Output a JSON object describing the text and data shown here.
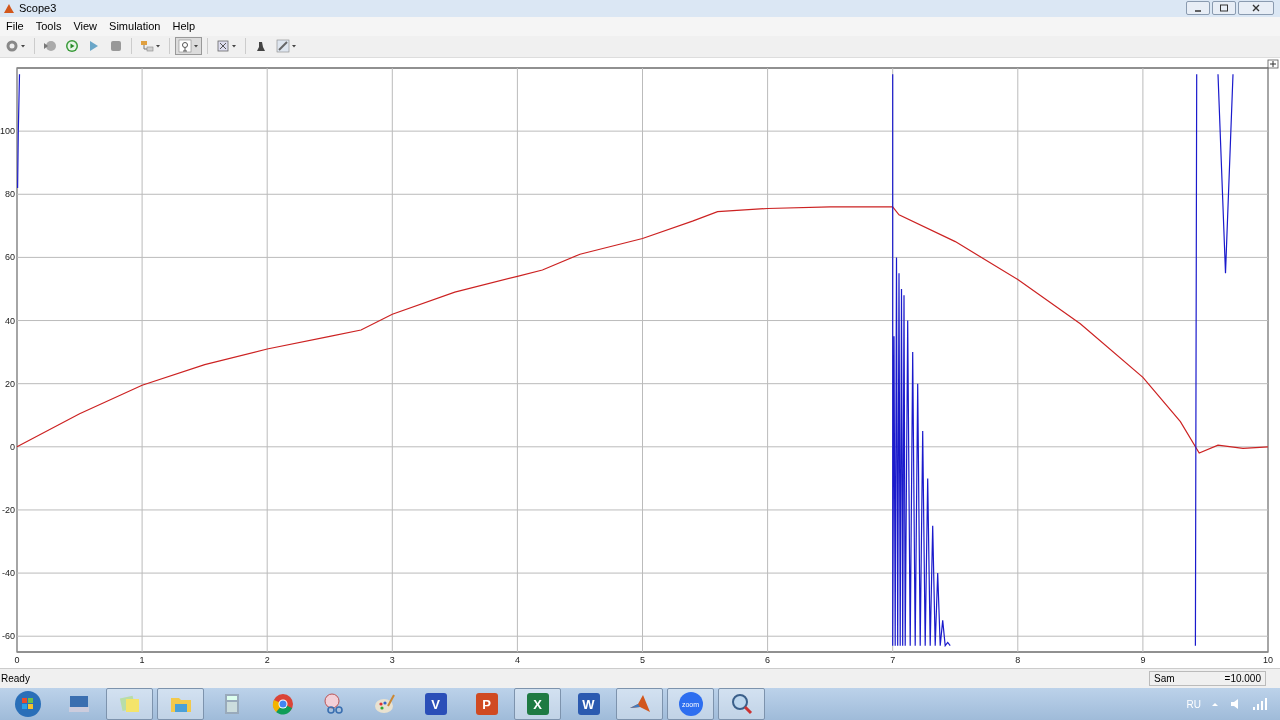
{
  "window": {
    "title": "Scope3"
  },
  "menu": [
    "File",
    "Tools",
    "View",
    "Simulation",
    "Help"
  ],
  "toolbar": [
    {
      "kind": "gear",
      "caret": true,
      "pressed": false
    },
    {
      "kind": "step-back",
      "caret": false,
      "pressed": false
    },
    {
      "kind": "run",
      "caret": false,
      "pressed": false
    },
    {
      "kind": "play",
      "caret": false,
      "pressed": false
    },
    {
      "kind": "stop",
      "caret": false,
      "pressed": false
    },
    {
      "kind": "blocks",
      "caret": true,
      "pressed": false
    },
    {
      "kind": "zoom",
      "caret": true,
      "pressed": true
    },
    {
      "kind": "fit",
      "caret": true,
      "pressed": false
    },
    {
      "kind": "stamp",
      "caret": false,
      "pressed": false
    },
    {
      "kind": "pencil",
      "caret": true,
      "pressed": false
    }
  ],
  "plot": {
    "chart_data": {
      "type": "line",
      "grid": true,
      "xlim": [
        0,
        10
      ],
      "ylim": [
        -65,
        120
      ],
      "xticks": [
        0,
        1,
        2,
        3,
        4,
        5,
        6,
        7,
        8,
        9,
        10
      ],
      "yticks": [
        -60,
        -40,
        -20,
        0,
        20,
        40,
        60,
        80,
        100
      ],
      "series": [
        {
          "color": "#cc2222",
          "x": [
            0,
            0.5,
            1,
            1.5,
            2,
            2.5,
            2.75,
            3,
            3.5,
            4,
            4.2,
            4.5,
            5,
            5.4,
            5.6,
            6,
            6.5,
            7,
            7.05,
            7.5,
            8,
            8.5,
            9,
            9.3,
            9.45,
            9.6,
            9.8,
            10
          ],
          "values": [
            0,
            10.5,
            19.5,
            26,
            31,
            35,
            37,
            42,
            49,
            54,
            56,
            61,
            66,
            71.5,
            74.5,
            75.5,
            76,
            76,
            73.5,
            65,
            53,
            39,
            22,
            8,
            -2,
            0.5,
            -0.5,
            0
          ]
        },
        {
          "color": "#1a1acc",
          "x": [
            0.005,
            0.01,
            0.02,
            null,
            7,
            7,
            7.01,
            7.02,
            7.03,
            7.04,
            7.05,
            7.06,
            7.07,
            7.08,
            7.09,
            7.1,
            7.12,
            7.14,
            7.16,
            7.18,
            7.2,
            7.22,
            7.24,
            7.26,
            7.28,
            7.3,
            7.32,
            7.34,
            7.36,
            7.38,
            7.4,
            7.42,
            7.44,
            7.46,
            null,
            9.42,
            9.43,
            null,
            9.6,
            9.66,
            9.72
          ],
          "values": [
            82,
            100,
            118,
            null,
            118,
            -63,
            35,
            -63,
            60,
            -63,
            55,
            -63,
            50,
            -63,
            48,
            -63,
            40,
            -63,
            30,
            -63,
            20,
            -63,
            5,
            -63,
            -10,
            -63,
            -25,
            -63,
            -40,
            -63,
            -55,
            -63,
            -62,
            -63,
            null,
            -63,
            118,
            null,
            118,
            55,
            118
          ]
        }
      ]
    }
  },
  "status": {
    "text": "Ready",
    "sample_parts": [
      "Sam",
      "=10.000"
    ]
  },
  "taskbar": [
    {
      "kind": "start",
      "pressed": false
    },
    {
      "kind": "keyboard",
      "pressed": false
    },
    {
      "kind": "notes",
      "pressed": true
    },
    {
      "kind": "folder",
      "pressed": true
    },
    {
      "kind": "calculator",
      "pressed": false
    },
    {
      "kind": "browser",
      "pressed": false
    },
    {
      "kind": "scissors",
      "pressed": false
    },
    {
      "kind": "palette",
      "pressed": false
    },
    {
      "kind": "letter",
      "label": "V",
      "color": "#2b4fb8",
      "pressed": false
    },
    {
      "kind": "letter",
      "label": "P",
      "color": "#d04a22",
      "pressed": false
    },
    {
      "kind": "letter",
      "label": "X",
      "color": "#1f7a43",
      "pressed": true
    },
    {
      "kind": "letter",
      "label": "W",
      "color": "#2b5ab0",
      "pressed": false
    },
    {
      "kind": "peak",
      "pressed": true
    },
    {
      "kind": "letter",
      "label": "zoom",
      "color": "#2d6ef0",
      "pressed": true
    },
    {
      "kind": "magnifier",
      "pressed": true
    }
  ],
  "tray": {
    "language": "RU"
  }
}
